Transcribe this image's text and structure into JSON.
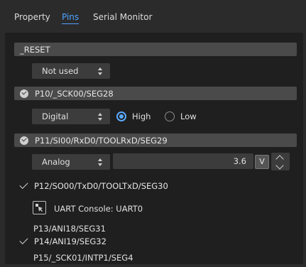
{
  "tabs": [
    {
      "label": "Property"
    },
    {
      "label": "Pins"
    },
    {
      "label": "Serial Monitor"
    }
  ],
  "pins": {
    "reset": {
      "name": "_RESET",
      "mode": "Not used"
    },
    "p10": {
      "name": "P10/_SCK00/SEG28",
      "mode": "Digital",
      "radio_high": "High",
      "radio_low": "Low"
    },
    "p11": {
      "name": "P11/SI00/RxD0/TOOLRxD/SEG29",
      "mode": "Analog",
      "value": "3.6",
      "unit": "V"
    },
    "p12": {
      "name": "P12/SO00/TxD0/TOOLTxD/SEG30",
      "console_label": "UART Console: UART0"
    },
    "p13": {
      "name": "P13/ANI18/SEG31"
    },
    "p14": {
      "name": "P14/ANI19/SEG32"
    },
    "p15": {
      "name": "P15/_SCK01/INTP1/SEG4"
    }
  },
  "colors": {
    "accent": "#4ea3ff",
    "background": "#2b2b2b",
    "panel": "#1f1f1f",
    "header": "#4a4a4a",
    "control": "#3c3c3c"
  }
}
